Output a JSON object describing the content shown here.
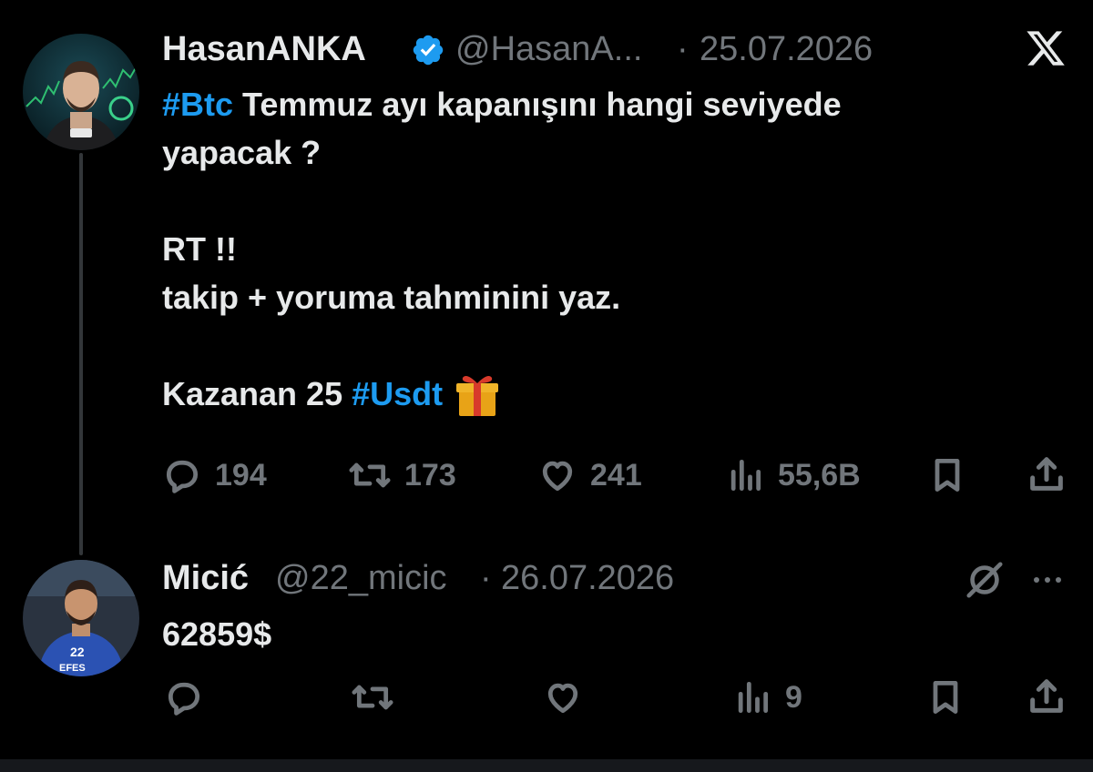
{
  "main_tweet": {
    "author_name": "HasanANKA",
    "handle": "@HasanA...",
    "separator": "·",
    "date": "25.07.2026",
    "text": {
      "hashtag_btc": "#Btc",
      "line1_rest": " Temmuz ayı kapanışını hangi seviyede",
      "line2": "yapacak ?",
      "line3": "RT !!",
      "line4": "takip + yoruma tahminini yaz.",
      "line5_prefix": "Kazanan 25 ",
      "hashtag_usdt": "#Usdt"
    },
    "stats": {
      "replies": "194",
      "reposts": "173",
      "likes": "241",
      "views": "55,6B"
    }
  },
  "reply_tweet": {
    "author_name": "Micić",
    "handle": "@22_micic",
    "separator": "·",
    "date": "26.07.2026",
    "text": "62859$",
    "stats": {
      "views": "9"
    }
  },
  "colors": {
    "background": "#000000",
    "text": "#e7e9ea",
    "muted": "#71767b",
    "accent": "#1d9bf0",
    "thread_line": "#333639"
  },
  "icons": [
    "x-logo-icon",
    "verified-badge-icon",
    "reply-icon",
    "repost-icon",
    "like-icon",
    "views-icon",
    "bookmark-icon",
    "share-icon",
    "more-icon",
    "grok-icon",
    "gift-icon"
  ]
}
